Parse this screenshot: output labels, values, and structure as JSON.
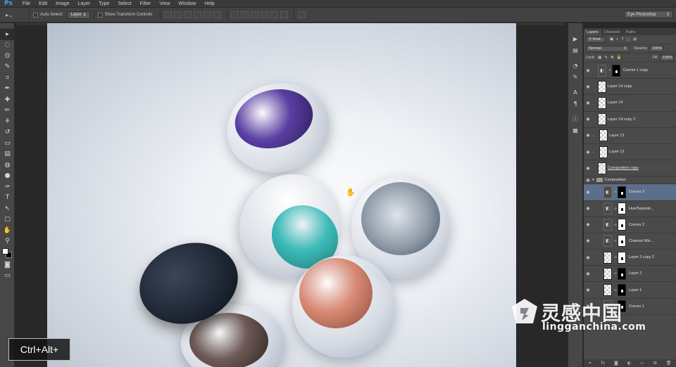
{
  "app": {
    "logo": "Ps"
  },
  "menu": [
    "File",
    "Edit",
    "Image",
    "Layer",
    "Type",
    "Select",
    "Filter",
    "View",
    "Window",
    "Help"
  ],
  "options": {
    "auto_select_label": "Auto-Select:",
    "auto_select_target": "Layer",
    "show_transform_label": "Show Transform Controls",
    "workspace": "Eye Photoshop"
  },
  "toolbox": {
    "icons": [
      "move-icon",
      "marquee-icon",
      "lasso-icon",
      "quick-select-icon",
      "crop-icon",
      "eyedropper-icon",
      "healing-icon",
      "brush-icon",
      "clone-stamp-icon",
      "history-brush-icon",
      "eraser-icon",
      "gradient-icon",
      "blur-icon",
      "dodge-icon",
      "pen-icon",
      "type-icon",
      "path-select-icon",
      "shape-icon",
      "hand-icon",
      "zoom-icon"
    ],
    "glyphs": [
      "▸",
      "◌",
      "ʘ",
      "✎",
      "⌗",
      "✒",
      "✚",
      "✏",
      "⚘",
      "↺",
      "▭",
      "▤",
      "◍",
      "●",
      "✑",
      "T",
      "↖",
      "▢",
      "✋",
      "⚲"
    ],
    "foreground_color": "#ffffff",
    "background_color": "#000000"
  },
  "canvas": {
    "background_color": "#e8ecf1",
    "jar_colors": {
      "purple": "#5b3fa3",
      "teal": "#3bbab8",
      "silver": "#8e9aa8",
      "peach": "#d98a74",
      "cap": "#1d2533",
      "brown": "#6e5a56"
    }
  },
  "overlay": {
    "shortcut": "Ctrl+Alt+"
  },
  "layers_panel": {
    "tabs": [
      "Layers",
      "Channels",
      "Paths"
    ],
    "filter_kind": "Kind",
    "blend_mode": "Normal",
    "opacity_label": "Opacity:",
    "opacity_value": "100%",
    "lock_label": "Lock:",
    "fill_label": "Fill:",
    "fill_value": "100%",
    "layers": [
      {
        "name": "Curves 1 copy",
        "type": "adjustment",
        "mask": "black"
      },
      {
        "name": "Layer 14 copy",
        "type": "pixel"
      },
      {
        "name": "Layer 14",
        "type": "pixel"
      },
      {
        "name": "Layer 14 copy 2",
        "type": "pixel"
      },
      {
        "name": "Layer 13",
        "type": "pixel",
        "clipped": true
      },
      {
        "name": "Layer 12",
        "type": "pixel",
        "clipped": true
      },
      {
        "name": "Composition copy",
        "type": "pixel",
        "underline": true
      }
    ],
    "group_name": "Composition",
    "group_layers": [
      {
        "name": "Curves 3",
        "type": "adjustment",
        "mask": "black",
        "selected": true
      },
      {
        "name": "Hue/Saturati...",
        "type": "adjustment",
        "mask": "white"
      },
      {
        "name": "Curves 2",
        "type": "adjustment",
        "mask": "white"
      },
      {
        "name": "Channel Mix...",
        "type": "adjustment",
        "mask": "white"
      },
      {
        "name": "Layer 2 copy 2",
        "type": "pixel",
        "mask": "white"
      },
      {
        "name": "Layer 2",
        "type": "pixel",
        "mask": "black"
      },
      {
        "name": "Layer 1",
        "type": "pixel",
        "mask": "black"
      },
      {
        "name": "Curves 1",
        "type": "adjustment",
        "mask": "black"
      }
    ],
    "footer_icons": [
      "link-icon",
      "fx-icon",
      "mask-icon",
      "adjustment-icon",
      "folder-icon",
      "new-layer-icon",
      "trash-icon"
    ],
    "footer_glyphs": [
      "⚭",
      "fx",
      "◙",
      "◐",
      "▭",
      "⊞",
      "🗑"
    ]
  },
  "watermark": {
    "cn": "灵感中国",
    "en": "lingganchina.com"
  }
}
